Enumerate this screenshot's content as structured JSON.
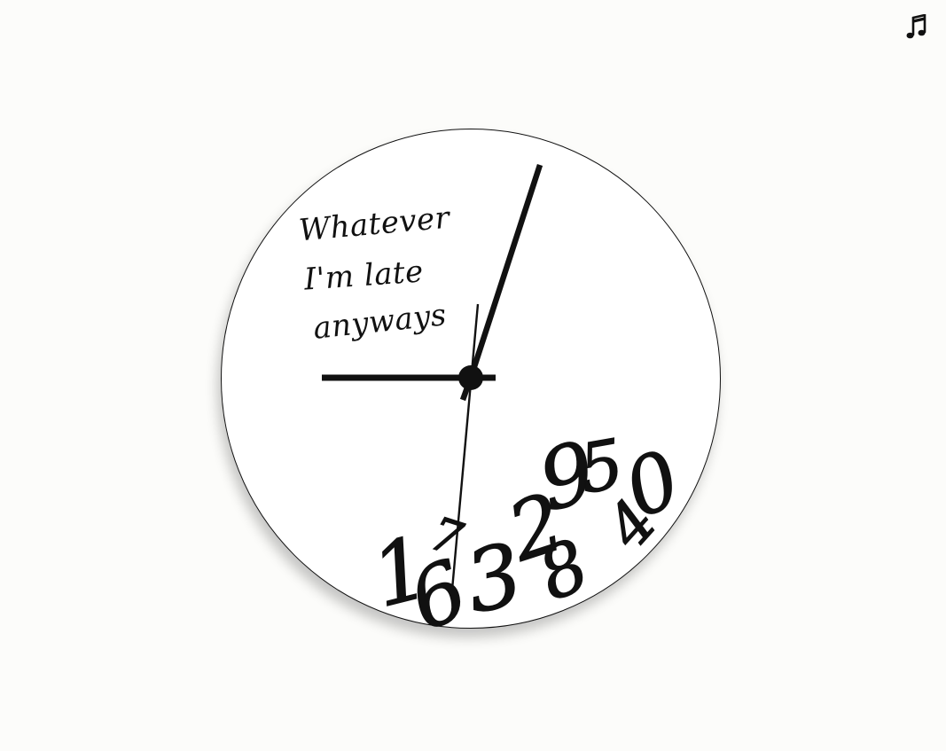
{
  "music": {
    "icon": "music-note-icon"
  },
  "clock": {
    "slogan": [
      "Whatever",
      "I'm late",
      "anyways"
    ],
    "fallen_numerals": [
      "1",
      "7",
      "6",
      "3",
      "2",
      "9",
      "5",
      "8",
      "4",
      "0"
    ],
    "colors": {
      "face": "#ffffff",
      "ink": "#111111",
      "background": "#fcfcfa"
    }
  }
}
